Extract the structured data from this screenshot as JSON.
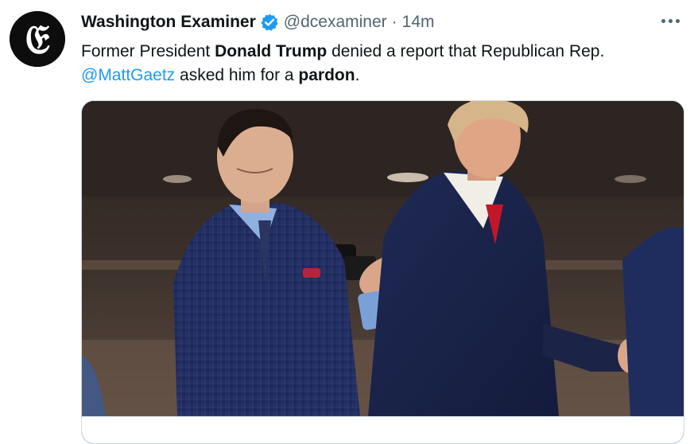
{
  "author": {
    "display_name": "Washington Examiner",
    "handle": "@dcexaminer",
    "separator": "·",
    "time": "14m",
    "avatar_logo": "𝔈",
    "verified_icon": "verified-badge-icon"
  },
  "tweet": {
    "text_1": "Former President ",
    "bold_1": "Donald Trump",
    "text_2": " denied a report that Republican Rep. ",
    "mention": "@MattGaetz",
    "text_3": " asked him for a ",
    "bold_2": "pardon",
    "text_4": "."
  },
  "icons": {
    "more": "more-options-icon"
  },
  "colors": {
    "text": "#0f1419",
    "muted": "#536471",
    "link": "#1d9bf0",
    "verified": "#1d9bf0",
    "border": "#cfd9de"
  }
}
